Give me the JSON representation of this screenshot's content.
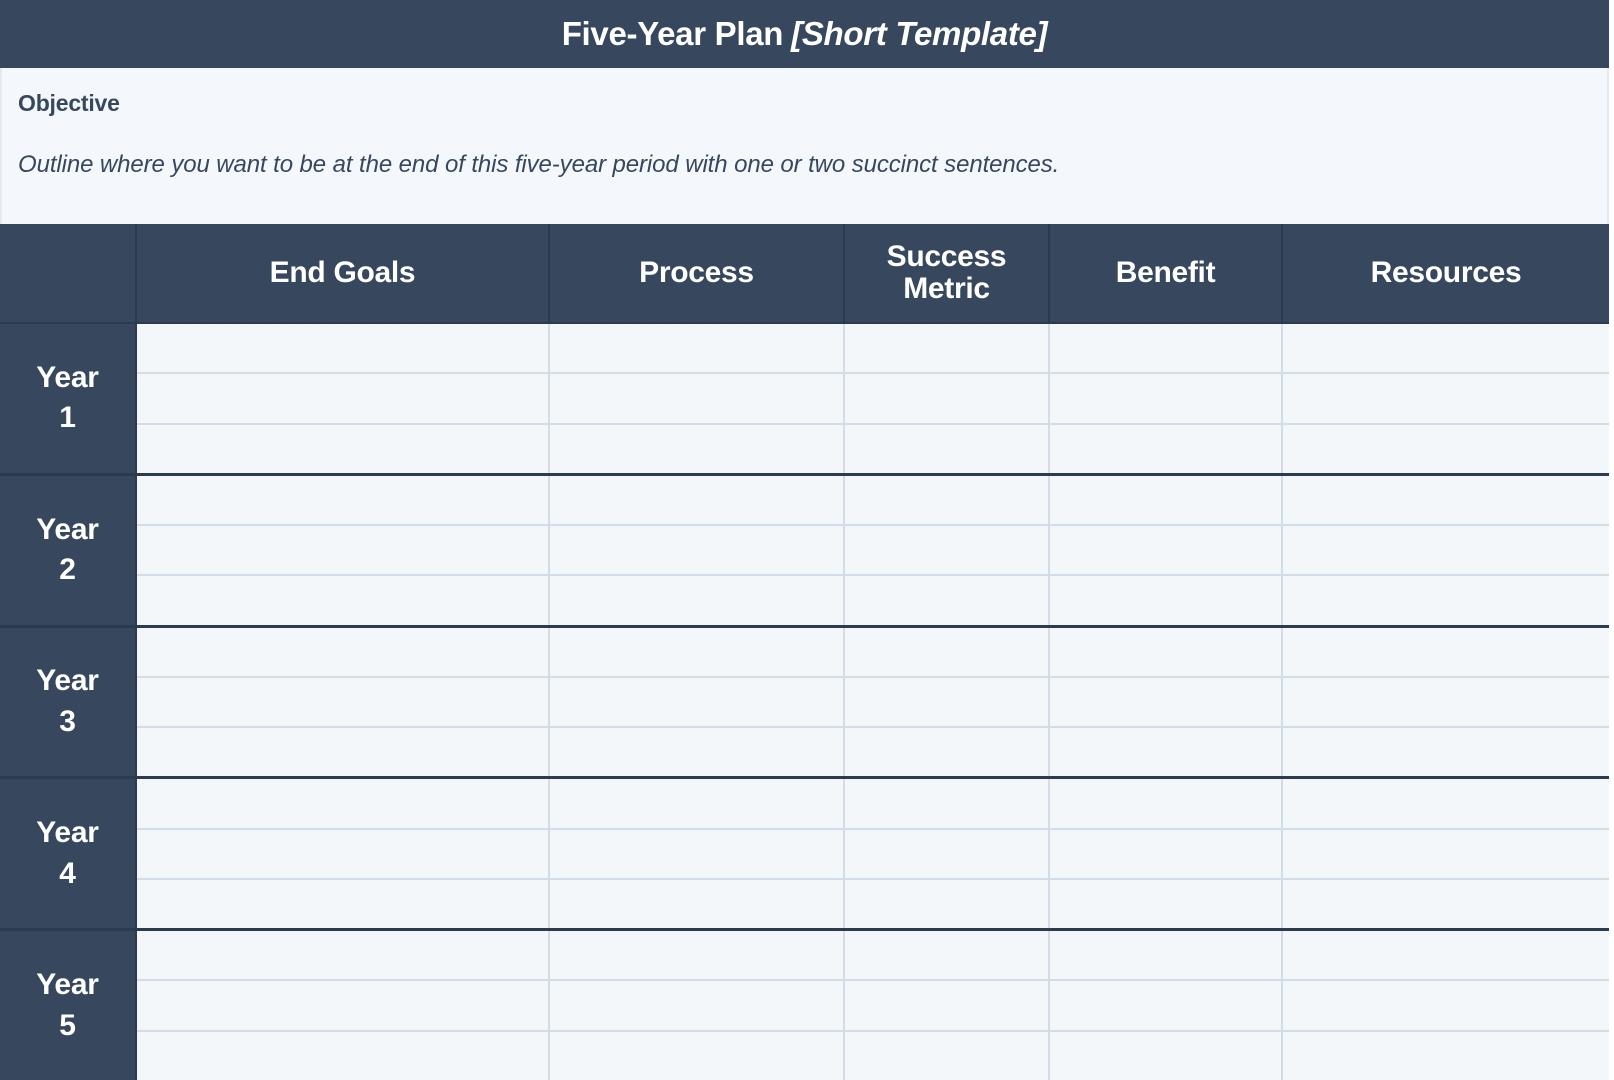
{
  "title": {
    "main": "Five-Year Plan",
    "bracketed": "[Short Template]"
  },
  "objective": {
    "label": "Objective",
    "description": "Outline where you want to be at the end of this five-year period with one or two succinct sentences."
  },
  "table": {
    "corner_label": "",
    "columns": [
      {
        "key": "end_goals",
        "label": "End Goals"
      },
      {
        "key": "process",
        "label": "Process"
      },
      {
        "key": "success_metric",
        "label": "Success Metric"
      },
      {
        "key": "benefit",
        "label": "Benefit"
      },
      {
        "key": "resources",
        "label": "Resources"
      }
    ],
    "rows": [
      {
        "label_line1": "Year",
        "label_line2": "1",
        "entries": [
          "",
          "",
          "",
          "",
          ""
        ]
      },
      {
        "label_line1": "Year",
        "label_line2": "2",
        "entries": [
          "",
          "",
          "",
          "",
          ""
        ]
      },
      {
        "label_line1": "Year",
        "label_line2": "3",
        "entries": [
          "",
          "",
          "",
          "",
          ""
        ]
      },
      {
        "label_line1": "Year",
        "label_line2": "4",
        "entries": [
          "",
          "",
          "",
          "",
          ""
        ]
      },
      {
        "label_line1": "Year",
        "label_line2": "5",
        "entries": [
          "",
          "",
          "",
          "",
          ""
        ]
      }
    ],
    "subrows_per_year": 3
  },
  "colors": {
    "header_navy": "#36475e",
    "header_divider": "#2b3a4e",
    "panel_bg": "#f4f8fc",
    "cell_bg": "#f4f7fa",
    "grid_line": "#d2dde8",
    "text_light": "#ffffff"
  }
}
